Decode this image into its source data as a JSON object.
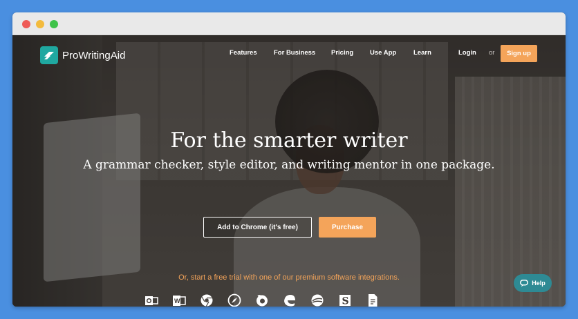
{
  "app": {
    "logo_text": "ProWritingAid"
  },
  "nav": {
    "items": [
      {
        "label": "Features"
      },
      {
        "label": "For Business"
      },
      {
        "label": "Pricing"
      },
      {
        "label": "Use App"
      },
      {
        "label": "Learn"
      }
    ],
    "login_label": "Login",
    "or_label": "or",
    "signup_label": "Sign up"
  },
  "hero": {
    "headline": "For the smarter writer",
    "subhead": "A grammar checker, style editor, and writing mentor in one package.",
    "chrome_button": "Add to Chrome (it's free)",
    "purchase_button": "Purchase",
    "trial_text": "Or, start a free trial with one of our premium software integrations."
  },
  "integrations": [
    {
      "icon": "outlook-icon"
    },
    {
      "icon": "word-icon"
    },
    {
      "icon": "chrome-icon"
    },
    {
      "icon": "safari-icon"
    },
    {
      "icon": "firefox-icon"
    },
    {
      "icon": "edge-icon"
    },
    {
      "icon": "openoffice-icon"
    },
    {
      "icon": "scrivener-icon"
    },
    {
      "icon": "google-docs-icon"
    }
  ],
  "help": {
    "label": "Help"
  },
  "colors": {
    "accent": "#f4a45a",
    "brand": "#1fa8a0",
    "help": "#2e8a94",
    "desktop": "#4a8fe0"
  }
}
